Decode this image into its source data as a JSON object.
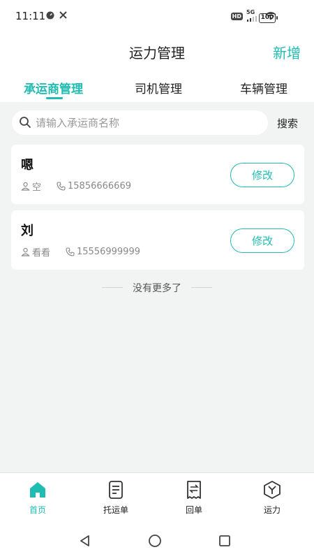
{
  "status_bar": {
    "time": "11:11",
    "network_badge": "HD",
    "network_type": "5G",
    "battery": "100"
  },
  "header": {
    "title": "运力管理",
    "add_label": "新增"
  },
  "tabs": [
    {
      "label": "承运商管理",
      "active": true
    },
    {
      "label": "司机管理",
      "active": false
    },
    {
      "label": "车辆管理",
      "active": false
    }
  ],
  "search": {
    "placeholder": "请输入承运商名称",
    "value": "",
    "button_label": "搜索"
  },
  "carriers": [
    {
      "name": "嗯",
      "contact": "空",
      "phone": "15856666669",
      "edit_label": "修改"
    },
    {
      "name": "刘",
      "contact": "看看",
      "phone": "15556999999",
      "edit_label": "修改"
    }
  ],
  "no_more_text": "没有更多了",
  "bottom_nav": [
    {
      "label": "首页",
      "icon": "home-icon",
      "active": true
    },
    {
      "label": "托运单",
      "icon": "document-icon",
      "active": false
    },
    {
      "label": "回单",
      "icon": "receipt-icon",
      "active": false
    },
    {
      "label": "运力",
      "icon": "cube-icon",
      "active": false
    }
  ],
  "colors": {
    "accent": "#1fbcb2",
    "background": "#f2f3f3"
  }
}
